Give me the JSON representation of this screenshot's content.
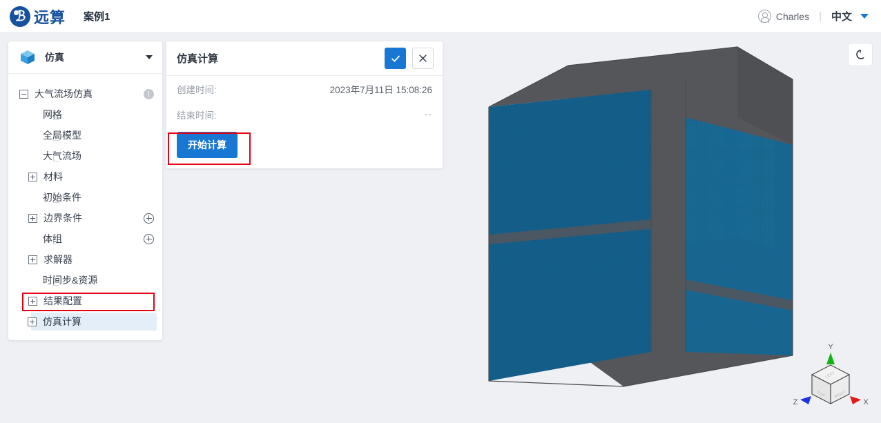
{
  "header": {
    "brand_name": "远算",
    "logo_icon": "yuansuan-logo-icon",
    "case_title": "案例1",
    "user_icon": "user-avatar-icon",
    "user_name": "Charles",
    "divider": "|",
    "language": "中文",
    "language_caret_icon": "chevron-down-icon",
    "accent_color": "#1877d2",
    "brand_color": "#15519e"
  },
  "sidebar": {
    "head": {
      "icon": "cube-icon",
      "label": "仿真",
      "caret_icon": "chevron-down-icon"
    },
    "tree": [
      {
        "label": "大气流场仿真",
        "toggle": "minus",
        "level": 0,
        "suffix_icon": "info-icon",
        "selected": false
      },
      {
        "label": "网格",
        "toggle": "none",
        "level": 1,
        "suffix_icon": "",
        "selected": false
      },
      {
        "label": "全局模型",
        "toggle": "none",
        "level": 1,
        "suffix_icon": "",
        "selected": false
      },
      {
        "label": "大气流场",
        "toggle": "none",
        "level": 1,
        "suffix_icon": "",
        "selected": false
      },
      {
        "label": "材料",
        "toggle": "plus",
        "level": 1,
        "suffix_icon": "",
        "selected": false
      },
      {
        "label": "初始条件",
        "toggle": "none",
        "level": 1,
        "suffix_icon": "",
        "selected": false
      },
      {
        "label": "边界条件",
        "toggle": "plus",
        "level": 1,
        "suffix_icon": "plus-circle-icon",
        "selected": false
      },
      {
        "label": "体组",
        "toggle": "none",
        "level": 1,
        "suffix_icon": "plus-circle-icon",
        "selected": false
      },
      {
        "label": "求解器",
        "toggle": "plus",
        "level": 1,
        "suffix_icon": "",
        "selected": false
      },
      {
        "label": "时间步&资源",
        "toggle": "none",
        "level": 1,
        "suffix_icon": "",
        "selected": false
      },
      {
        "label": "结果配置",
        "toggle": "plus",
        "level": 1,
        "suffix_icon": "",
        "selected": false
      },
      {
        "label": "仿真计算",
        "toggle": "plus",
        "level": 1,
        "suffix_icon": "",
        "selected": true
      }
    ]
  },
  "panel": {
    "title": "仿真计算",
    "confirm_icon": "check-icon",
    "cancel_icon": "close-icon",
    "fields": [
      {
        "label": "创建时间:",
        "value": "2023年7月11日 15:08:26",
        "dim": false
      },
      {
        "label": "结束时间:",
        "value": "--",
        "dim": true
      }
    ],
    "start_button": "开始计算"
  },
  "viewport": {
    "reset_view_icon": "reset-view-icon",
    "model_name": "mesh-box-model",
    "mesh_color": "#16618c",
    "edge_color": "#55565a",
    "background_color": "#eef0f4",
    "axis_gizmo": {
      "name": "axis-orientation-cube",
      "axes": [
        {
          "label": "X",
          "color": "#e01b1b"
        },
        {
          "label": "Y",
          "color": "#12b312"
        },
        {
          "label": "Z",
          "color": "#1a35e0"
        }
      ],
      "faces": [
        "LEFT",
        "TOP",
        "RIGHT"
      ]
    }
  },
  "annotations": {
    "color": "#e60012",
    "boxes": [
      "sidebar-simulation-compute-item",
      "start-calculation-button"
    ]
  }
}
